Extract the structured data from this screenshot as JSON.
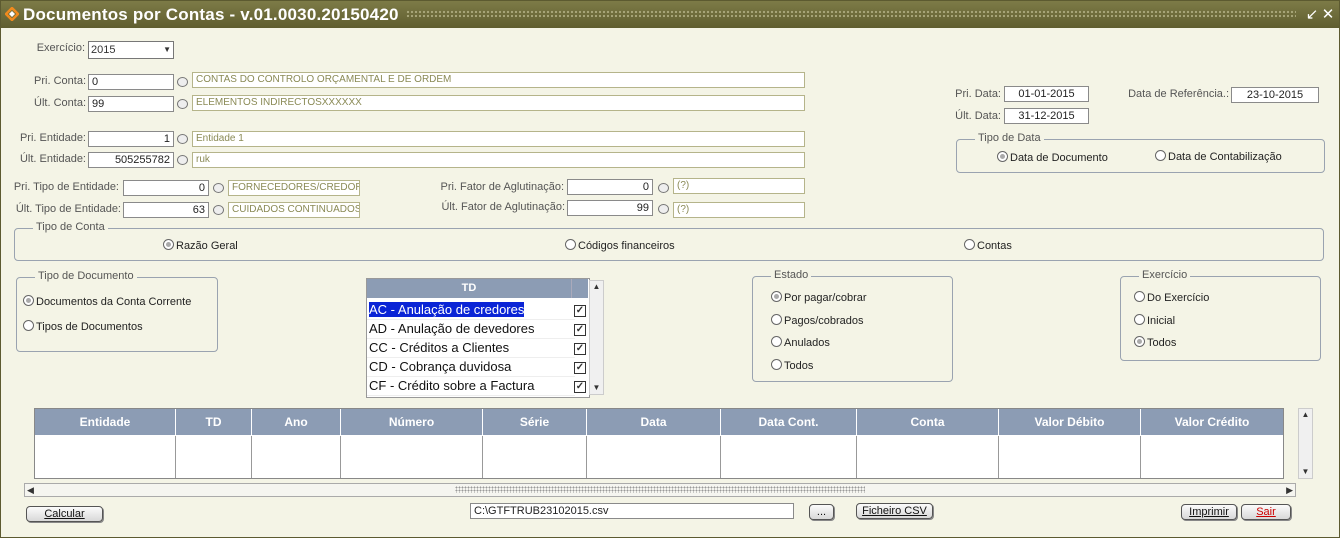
{
  "window": {
    "title": "Documentos por Contas  - v.01.0030.20150420"
  },
  "exercicio": {
    "label": "Exercício:",
    "value": "2015"
  },
  "contas": {
    "pri_label": "Pri. Conta:",
    "pri_value": "0",
    "pri_desc": "CONTAS DO CONTROLO ORÇAMENTAL E DE ORDEM",
    "ult_label": "Últ. Conta:",
    "ult_value": "99",
    "ult_desc": "ELEMENTOS INDIRECTOSXXXXXX"
  },
  "entidades": {
    "pri_label": "Pri. Entidade:",
    "pri_value": "1",
    "pri_desc": "Entidade 1",
    "ult_label": "Últ. Entidade:",
    "ult_value": "505255782",
    "ult_desc": "ruk"
  },
  "tipo_entidade": {
    "pri_label": "Pri. Tipo de Entidade:",
    "pri_value": "0",
    "pri_desc": "FORNECEDORES/CREDOR",
    "ult_label": "Últ. Tipo de Entidade:",
    "ult_value": "63",
    "ult_desc": "CUIDADOS CONTINUADOS"
  },
  "fator": {
    "pri_label": "Pri. Fator de Aglutinação:",
    "pri_value": "0",
    "pri_desc": "(?)",
    "ult_label": "Últ. Fator de Aglutinação:",
    "ult_value": "99",
    "ult_desc": "(?)"
  },
  "datas": {
    "pri_label": "Pri. Data:",
    "pri_value": "01-01-2015",
    "ult_label": "Últ. Data:",
    "ult_value": "31-12-2015",
    "ref_label": "Data de Referência.:",
    "ref_value": "23-10-2015"
  },
  "tipo_data": {
    "title": "Tipo de Data",
    "opt1": "Data de Documento",
    "opt2": "Data de Contabilização",
    "selected": "Data de Documento"
  },
  "tipo_conta": {
    "title": "Tipo de Conta",
    "opt1": "Razão Geral",
    "opt2": "Códigos financeiros",
    "opt3": "Contas",
    "selected": "Razão Geral"
  },
  "tipo_documento": {
    "title": "Tipo de Documento",
    "opt1": "Documentos da Conta Corrente",
    "opt2": "Tipos de Documentos",
    "selected": "Documentos da Conta Corrente"
  },
  "td_list": {
    "header": "TD",
    "items": [
      {
        "label": "AC - Anulação de credores",
        "checked": true,
        "selected": true
      },
      {
        "label": "AD - Anulação de devedores",
        "checked": true
      },
      {
        "label": "CC - Créditos a Clientes",
        "checked": true
      },
      {
        "label": "CD - Cobrança duvidosa",
        "checked": true
      },
      {
        "label": "CF - Crédito sobre a Factura",
        "checked": true
      }
    ]
  },
  "estado": {
    "title": "Estado",
    "opt1": "Por pagar/cobrar",
    "opt2": "Pagos/cobrados",
    "opt3": "Anulados",
    "opt4": "Todos",
    "selected": "Por pagar/cobrar"
  },
  "exercicio_group": {
    "title": "Exercício",
    "opt1": "Do Exercício",
    "opt2": "Inicial",
    "opt3": "Todos",
    "selected": "Todos"
  },
  "grid": {
    "columns": [
      "Entidade",
      "TD",
      "Ano",
      "Número",
      "Série",
      "Data",
      "Data Cont.",
      "Conta",
      "Valor Débito",
      "Valor Crédito"
    ],
    "rows": []
  },
  "footer": {
    "calcular": "Calcular",
    "file_path": "C:\\GTFTRUB23102015.csv",
    "browse": "...",
    "ficheiro_csv": "Ficheiro CSV",
    "imprimir": "Imprimir",
    "sair": "Sair"
  },
  "colors": {
    "title_bar": "#6b6939",
    "header_blue": "#8c9cb4",
    "selection": "#0a24d6",
    "sair_text": "#cc0000"
  }
}
